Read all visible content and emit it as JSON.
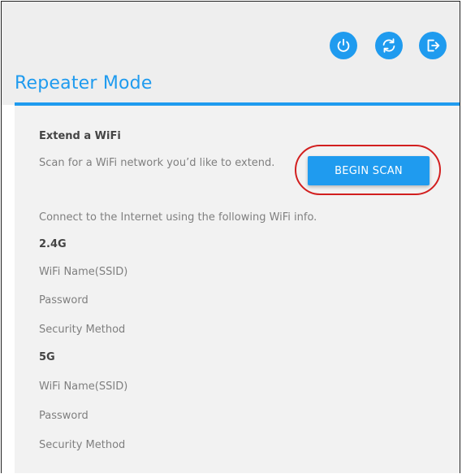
{
  "header": {
    "title": "Repeater Mode",
    "icons": [
      "power-icon",
      "refresh-icon",
      "logout-icon"
    ],
    "accent_color": "#1f9bef"
  },
  "extend": {
    "heading": "Extend a WiFi",
    "description": "Scan for a WiFi network you’d like to extend.",
    "scan_button_label": "BEGIN SCAN"
  },
  "connect": {
    "info_text": "Connect to the Internet using the following WiFi info."
  },
  "band_24": {
    "label": "2.4G",
    "ssid_label": "WiFi Name(SSID)",
    "password_label": "Password",
    "security_label": "Security Method"
  },
  "band_5": {
    "label": "5G",
    "ssid_label": "WiFi Name(SSID)",
    "password_label": "Password",
    "security_label": "Security Method"
  },
  "annotation_color": "#d21f1f"
}
